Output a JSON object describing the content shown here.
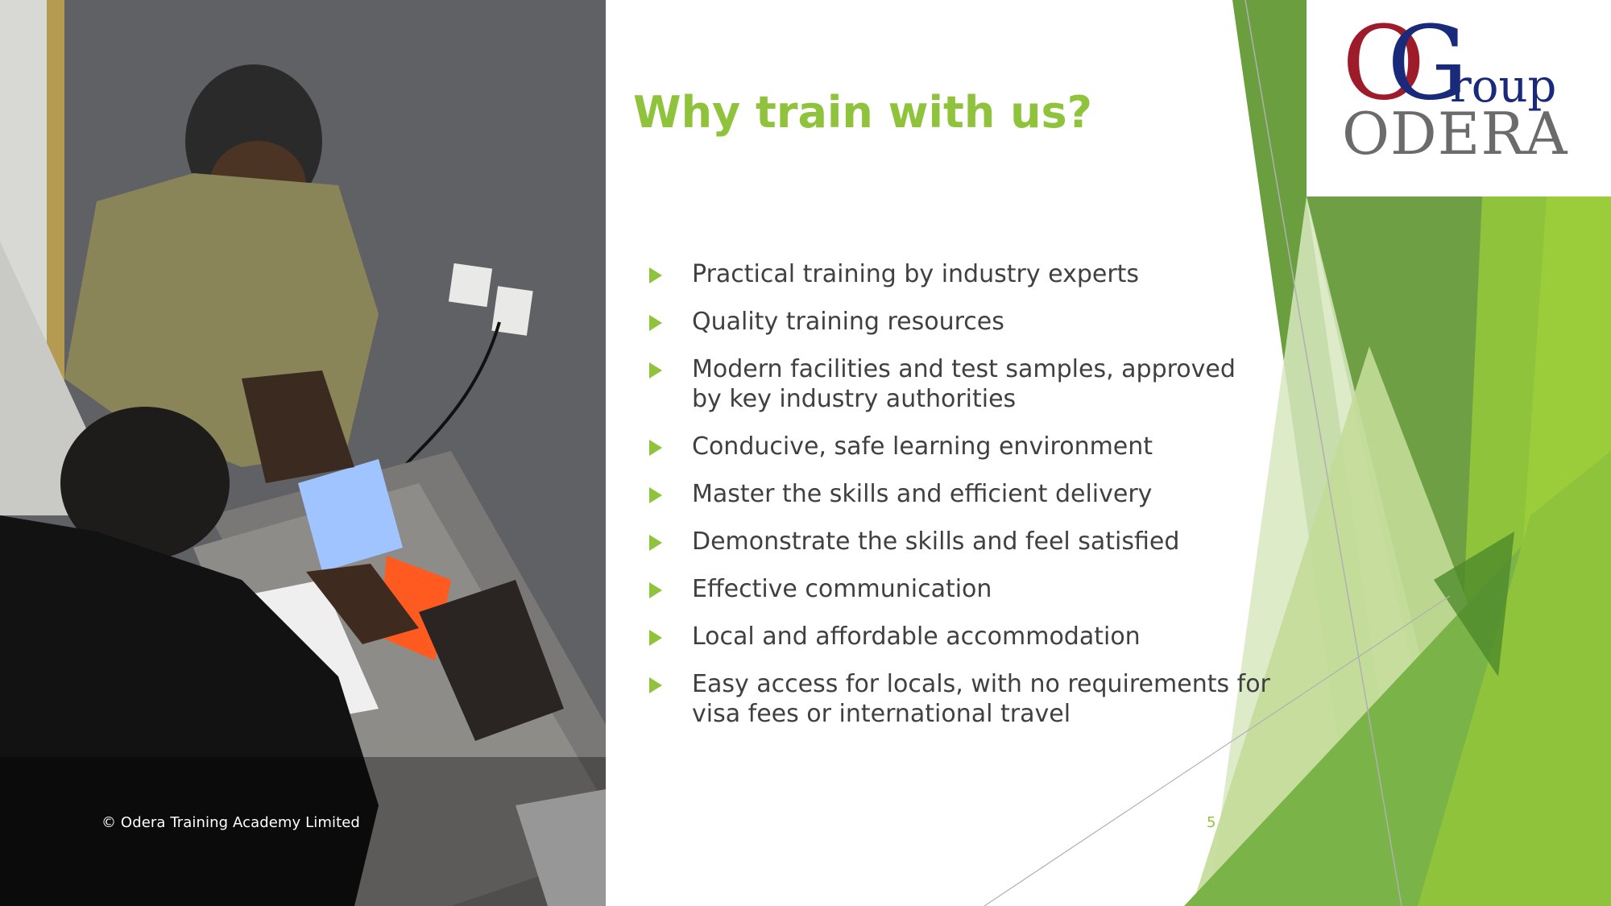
{
  "slide": {
    "title": "Why train with us?",
    "bullets": [
      {
        "text": "Practical training by industry experts"
      },
      {
        "text": "Quality training resources"
      },
      {
        "text": "Modern facilities and test samples, approved by key industry authorities"
      },
      {
        "text": "Conducive, safe learning environment"
      },
      {
        "text": "Master the skills and efficient delivery"
      },
      {
        "text": "Demonstrate the skills and feel satisfied"
      },
      {
        "text": "Effective communication"
      },
      {
        "text": "Local and affordable accommodation"
      },
      {
        "text": "Easy access for locals, with no requirements for visa fees or international travel"
      }
    ],
    "page_number": "5",
    "copyright": "© Odera Training Academy Limited",
    "bullet_icon": "triangle-arrow-icon"
  },
  "logo": {
    "letter_o": "O",
    "letter_g": "G",
    "roup": "roup",
    "odera": "ODERA"
  },
  "colors": {
    "accent_green": "#8fc33c",
    "text_gray": "#404040",
    "logo_red": "#9e1b2a",
    "logo_blue": "#1a2a7a",
    "logo_gray": "#6b6b6b"
  }
}
